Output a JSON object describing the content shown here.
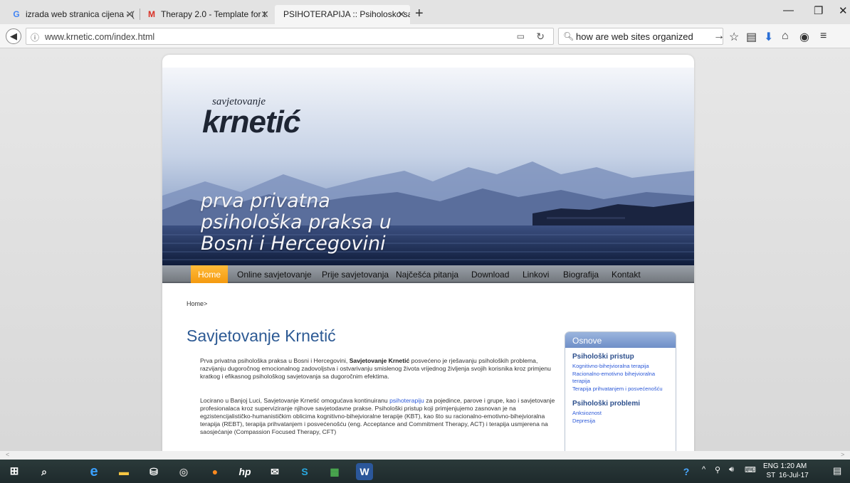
{
  "browser": {
    "tabs": [
      {
        "title": "izrada web stranica cijena - (",
        "icon": "google-icon"
      },
      {
        "title": "Therapy 2.0 - Template for t",
        "icon": "gmail-icon"
      },
      {
        "title": "PSIHOTERAPIJA :: Psiholosko sav",
        "icon": "none",
        "active": true
      }
    ],
    "url": "www.krnetic.com/index.html",
    "search_query": "how are web sites organized"
  },
  "site": {
    "logo_small": "savjetovanje",
    "logo_big": "krnetić",
    "tagline_lines": [
      "prva privatna",
      "psihološka praksa u",
      "Bosni i Hercegovini"
    ],
    "menu": [
      "Home",
      "Online savjetovanje",
      "Prije savjetovanja",
      "Najčešća pitanja",
      "Download",
      "Linkovi",
      "Biografija",
      "Kontakt"
    ],
    "breadcrumb": "Home>",
    "title": "Savjetovanje Krnetić",
    "para1_pre": "Prva privatna psihološka praksa u Bosni i Hercegovini, ",
    "para1_bold": "Savjetovanje Krnetić",
    "para1_post": " posvećeno je rješavanju psiholoških problema, razvijanju dugoročnog emocionalnog zadovoljstva i ostvarivanju smislenog života vrijednog življenja svojih korisnika kroz primjenu kratkog i efikasnog psihološkog savjetovanja sa dugoročnim efektima.",
    "para2_pre": "Locirano u Banjoj Luci, Savjetovanje Krnetić omogućava kontinuiranu ",
    "para2_link": "psihoterapiju",
    "para2_post": " za pojedince, parove i grupe, kao i savjetovanje profesionalaca kroz superviziranje njihove savjetodavne prakse. Psihološki pristup koji primjenjujemo zasnovan je na egzistencijalističko-humanističkim oblicima kognitivno-bihejvioralne terapije (KBT), kao što su racionalno-emotivno-bihejvioralna terapija (REBT), terapija prihvatanjem i posvećenošću (eng. Acceptance and Commitment Therapy, ACT) i terapija usmjerena na saosjećanje (Compassion Focused Therapy, CFT)",
    "sidebar": {
      "title": "Osnove",
      "section1": "Psihološki pristup",
      "links1": [
        "Kognitivno-bihejvioralna terapija",
        "Racionalno-emotivno bihejvioralna terapija",
        "Terapija prihvatanjem i posvećenošću"
      ],
      "section2": "Psihološki problemi",
      "links2": [
        "Anksioznost",
        "Depresija"
      ]
    }
  },
  "taskbar": {
    "lang_top": "ENG",
    "lang_bottom": "ST",
    "time": "1:20 AM",
    "date": "16-Jul-17"
  },
  "colors": {
    "menu_active": "#f49a0f",
    "title_blue": "#2d5a94",
    "link_blue": "#2d5ad8"
  }
}
